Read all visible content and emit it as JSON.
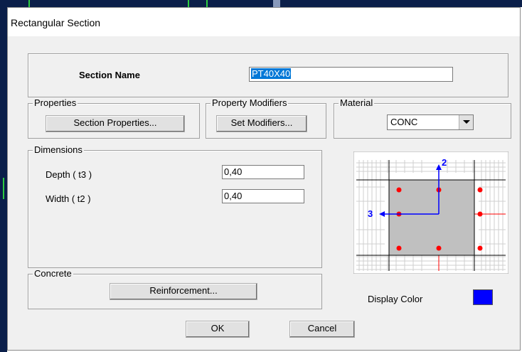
{
  "window": {
    "title": "Rectangular Section"
  },
  "section_name": {
    "label": "Section Name",
    "value": "PT40X40"
  },
  "properties": {
    "legend": "Properties",
    "button": "Section Properties..."
  },
  "property_modifiers": {
    "legend": "Property Modifiers",
    "button": "Set Modifiers..."
  },
  "material": {
    "legend": "Material",
    "selected": "CONC"
  },
  "dimensions": {
    "legend": "Dimensions",
    "depth": {
      "label": "Depth  ( t3 )",
      "value": "0,40"
    },
    "width": {
      "label": "Width  ( t2 )",
      "value": "0,40"
    }
  },
  "concrete": {
    "legend": "Concrete",
    "button": "Reinforcement..."
  },
  "preview": {
    "axis2_label": "2",
    "axis3_label": "3"
  },
  "display_color": {
    "label": "Display Color",
    "color": "#0000ff"
  },
  "actions": {
    "ok": "OK",
    "cancel": "Cancel"
  },
  "colors": {
    "selection": "#0078d7",
    "rebar": "#ff0000",
    "axis": "#0000ff",
    "section_fill": "#c0c0c0"
  }
}
